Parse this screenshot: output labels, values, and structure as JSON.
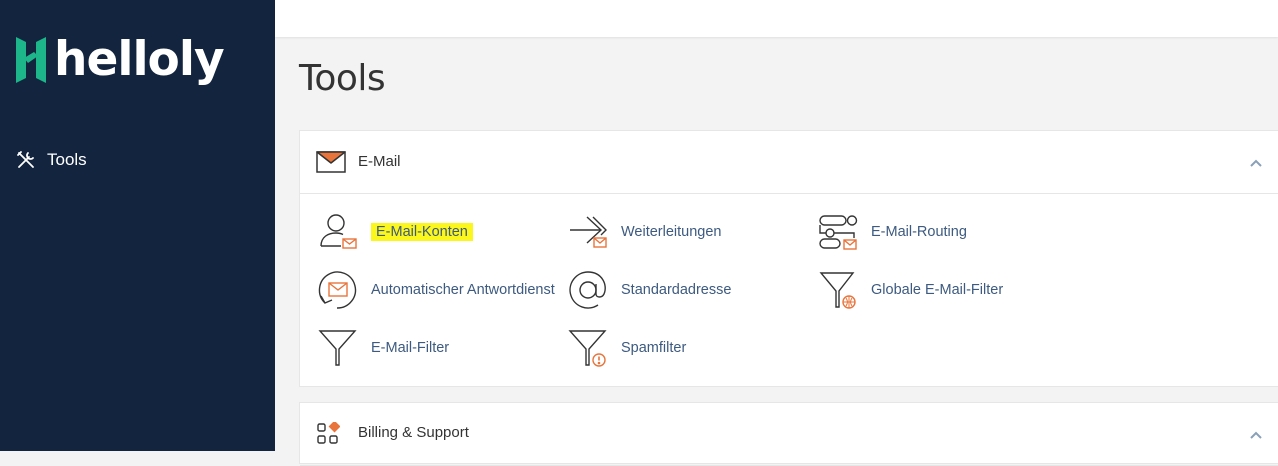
{
  "brand": {
    "logo_text": "helloly"
  },
  "sidebar": {
    "items": [
      {
        "label": "Tools",
        "icon": "tools-icon"
      }
    ]
  },
  "page": {
    "title": "Tools"
  },
  "sections": [
    {
      "title": "E-Mail",
      "icon": "envelope-icon",
      "tools": [
        {
          "label": "E-Mail-Konten",
          "icon": "email-accounts-icon",
          "highlighted": true,
          "highlight_color": "#fbf61c"
        },
        {
          "label": "Weiterleitungen",
          "icon": "forwarders-icon"
        },
        {
          "label": "E-Mail-Routing",
          "icon": "email-routing-icon"
        },
        {
          "label": "Automatischer Antwortdienst",
          "icon": "autoresponder-icon"
        },
        {
          "label": "Standardadresse",
          "icon": "default-address-icon"
        },
        {
          "label": "Globale E-Mail-Filter",
          "icon": "global-email-filter-icon"
        },
        {
          "label": "E-Mail-Filter",
          "icon": "email-filter-icon"
        },
        {
          "label": "Spamfilter",
          "icon": "spam-filter-icon"
        }
      ]
    },
    {
      "title": "Billing & Support",
      "icon": "grid-icon"
    }
  ],
  "colors": {
    "sidebar_bg": "#13243f",
    "accent_orange": "#e8743b",
    "link": "#3d5a80",
    "logo_green": "#1db58a"
  }
}
